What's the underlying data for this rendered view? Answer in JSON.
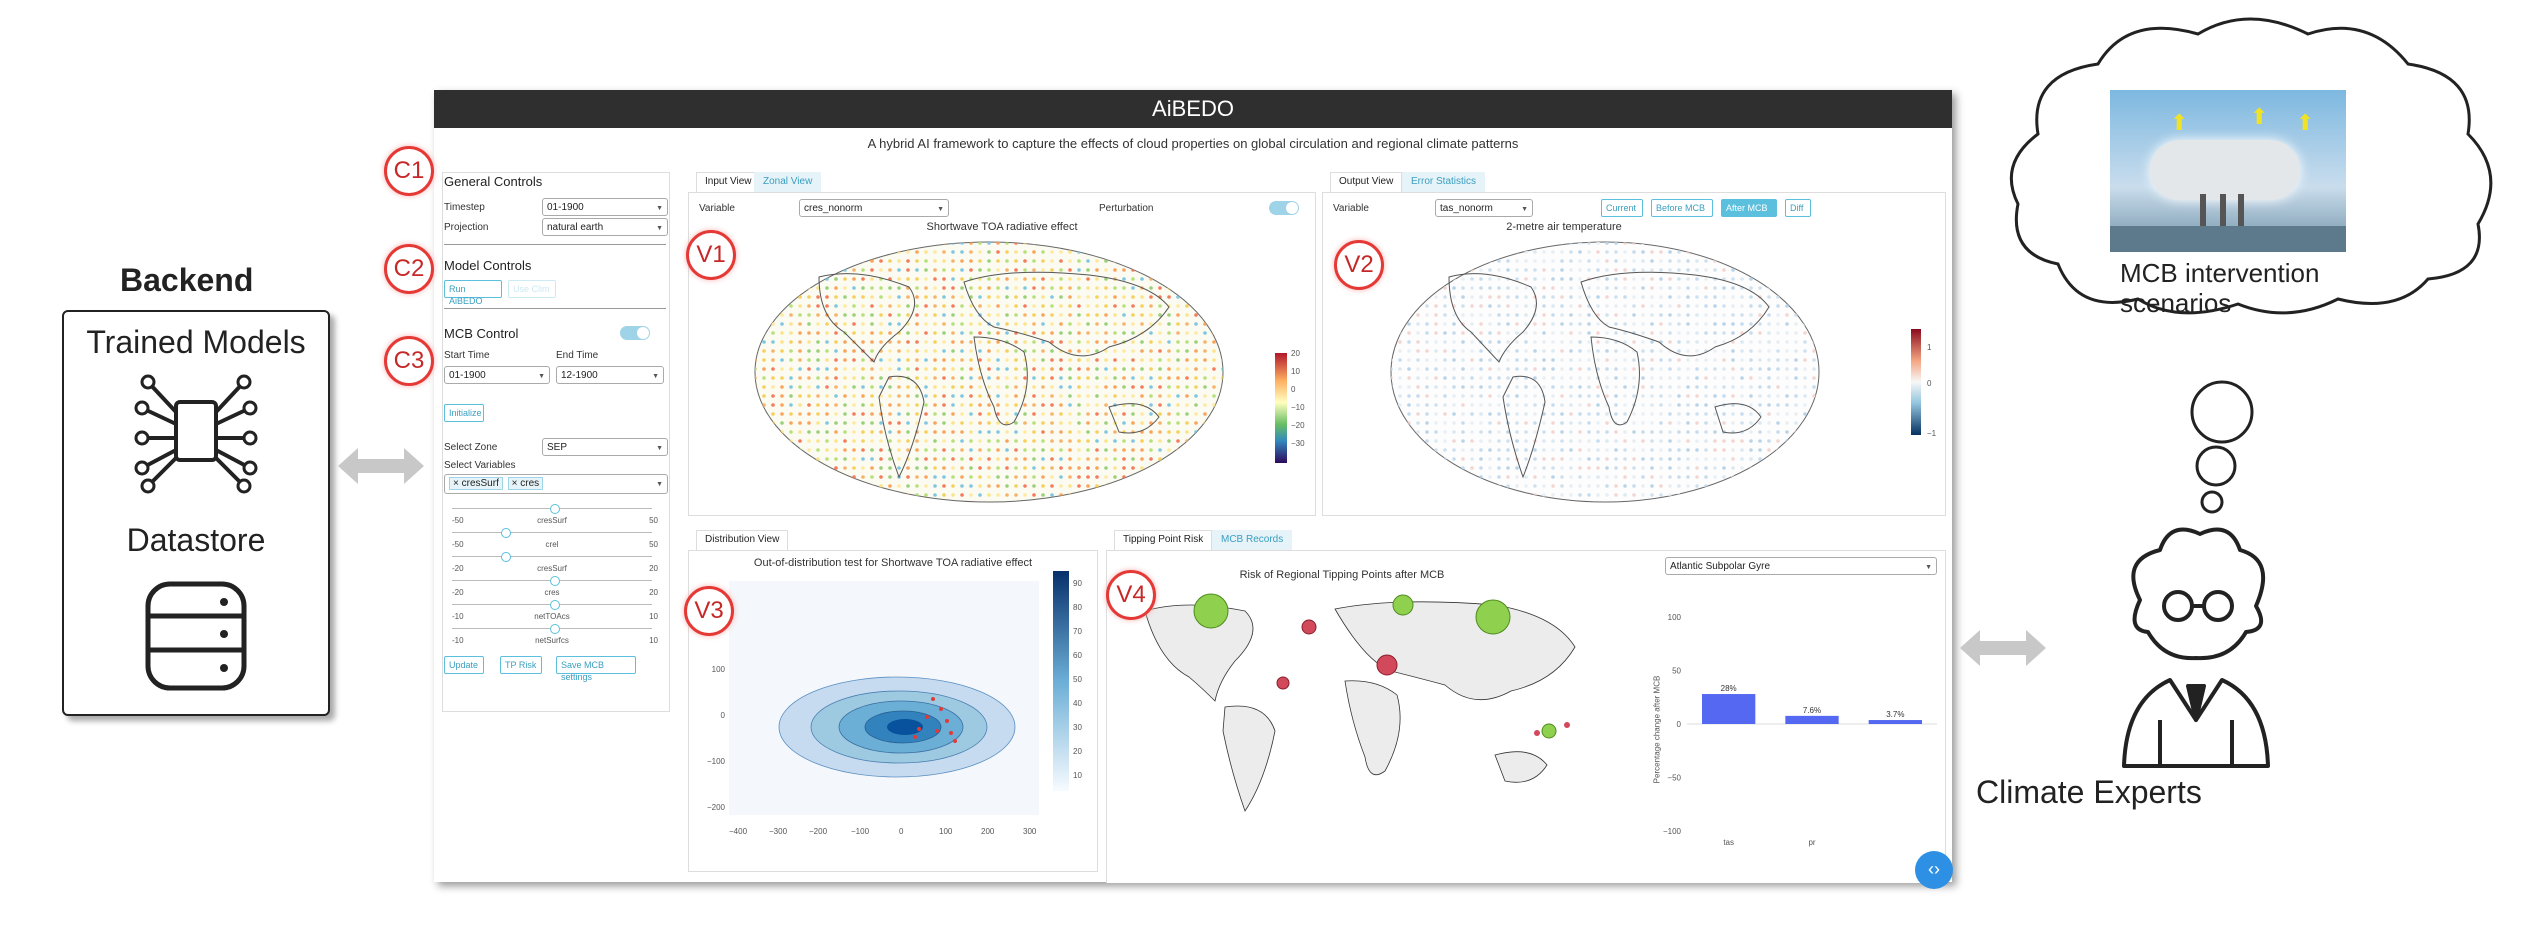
{
  "backend": {
    "title": "Backend",
    "models_label": "Trained Models",
    "datastore_label": "Datastore"
  },
  "app": {
    "title": "AiBEDO",
    "subtitle": "A hybrid AI framework to capture the effects of cloud properties on global circulation and regional climate patterns"
  },
  "badges": {
    "c1": "C1",
    "c2": "C2",
    "c3": "C3",
    "v1": "V1",
    "v2": "V2",
    "v3": "V3",
    "v4": "V4"
  },
  "general_controls": {
    "heading": "General Controls",
    "timestep_label": "Timestep",
    "timestep_value": "01-1900",
    "projection_label": "Projection",
    "projection_value": "natural earth"
  },
  "model_controls": {
    "heading": "Model Controls",
    "run_label": "Run AiBEDO",
    "disabled_label": "Use Clim"
  },
  "mcb_control": {
    "heading": "MCB Control",
    "start_label": "Start Time",
    "end_label": "End Time",
    "start_value": "01-1900",
    "end_value": "12-1900",
    "initialize_label": "Initialize",
    "zone_label": "Select Zone",
    "zone_value": "SEP",
    "variables_label": "Select Variables",
    "chips": [
      "cresSurf",
      "cres"
    ],
    "sliders": [
      {
        "name": "cresSurf",
        "min": "-50",
        "max": "50",
        "frac": 0.5
      },
      {
        "name": "crel",
        "min": "-50",
        "max": "50",
        "frac": 0.25
      },
      {
        "name": "cresSurf",
        "min": "-20",
        "max": "20",
        "frac": 0.25
      },
      {
        "name": "cres",
        "min": "-20",
        "max": "20",
        "frac": 0.5
      },
      {
        "name": "netTOAcs",
        "min": "-10",
        "max": "10",
        "frac": 0.5
      },
      {
        "name": "netSurfcs",
        "min": "-10",
        "max": "10",
        "frac": 0.5
      }
    ],
    "update_label": "Update",
    "tp_label": "TP Risk",
    "save_label": "Save MCB settings"
  },
  "v1": {
    "tab_active": "Input View",
    "tab_inactive": "Zonal View",
    "variable_label": "Variable",
    "variable_value": "cres_nonorm",
    "perturbation_label": "Perturbation",
    "map_title": "Shortwave TOA radiative effect",
    "colorbar_ticks": [
      "20",
      "10",
      "0",
      "−10",
      "−20",
      "−30"
    ]
  },
  "v2": {
    "tab_active": "Output View",
    "tab_inactive": "Error Statistics",
    "variable_label": "Variable",
    "variable_value": "tas_nonorm",
    "buttons": [
      "Current",
      "Before MCB",
      "After MCB",
      "Diff"
    ],
    "map_title": "2-metre air temperature",
    "colorbar_ticks": [
      "1",
      "0",
      "−1"
    ]
  },
  "v3": {
    "tab": "Distribution View",
    "title": "Out-of-distribution test for Shortwave TOA radiative effect",
    "y_ticks": [
      "100",
      "0",
      "−100",
      "−200"
    ],
    "x_ticks": [
      "−400",
      "−300",
      "−200",
      "−100",
      "0",
      "100",
      "200",
      "300"
    ],
    "colorbar_ticks": [
      "90",
      "80",
      "70",
      "60",
      "50",
      "40",
      "30",
      "20",
      "10"
    ]
  },
  "v4": {
    "tab_active": "Tipping Point Risk",
    "tab_inactive": "MCB Records",
    "map_title": "Risk of Regional Tipping Points after MCB",
    "dropdown_value": "Atlantic Subpolar Gyre",
    "ylabel": "Percentage change after MCB",
    "y_ticks": [
      "100",
      "50",
      "0",
      "−50",
      "−100"
    ],
    "chart_data": {
      "type": "bar",
      "categories": [
        "tas",
        "pr",
        ""
      ],
      "values": [
        28,
        7.6,
        3.7
      ],
      "labels": [
        "28%",
        "7.6%",
        "3.7%"
      ],
      "ylim": [
        -100,
        100
      ],
      "ylabel": "Percentage change after MCB",
      "color": "#5468f2"
    }
  },
  "cloud": {
    "label": "MCB intervention\nscenarios"
  },
  "experts": {
    "label": "Climate Experts"
  },
  "colors": {
    "accent": "#5bc0de",
    "badge": "#e53935",
    "title_bar": "#2f2f2f"
  }
}
